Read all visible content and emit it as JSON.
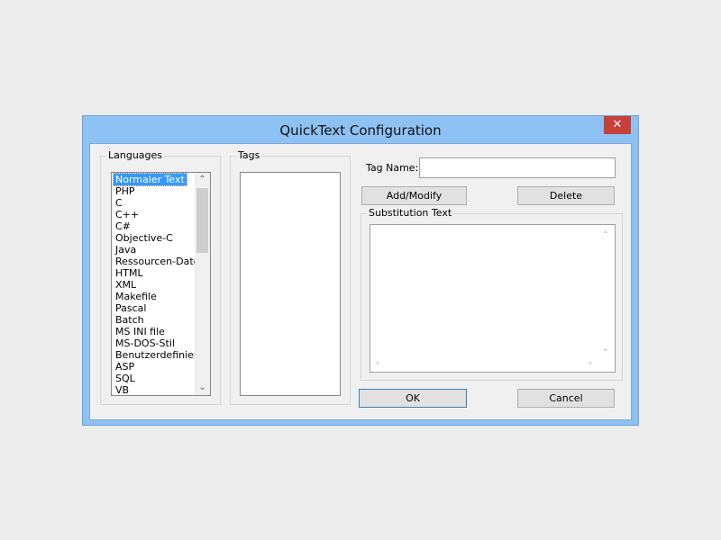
{
  "window": {
    "title": "QuickText Configuration",
    "close_glyph": "✕"
  },
  "languages": {
    "label": "Languages",
    "items": [
      "Normaler Text",
      "PHP",
      "C",
      "C++",
      "C#",
      "Objective-C",
      "Java",
      "Ressourcen-Datei",
      "HTML",
      "XML",
      "Makefile",
      "Pascal",
      "Batch",
      "MS INI file",
      "MS-DOS-Stil",
      "Benutzerdefiniert",
      "ASP",
      "SQL",
      "VB"
    ],
    "selected_index": 0
  },
  "tags": {
    "label": "Tags"
  },
  "tag_name": {
    "label": "Tag Name:",
    "value": ""
  },
  "buttons": {
    "add_modify": "Add/Modify",
    "delete": "Delete",
    "ok": "OK",
    "cancel": "Cancel"
  },
  "substitution": {
    "label": "Substitution Text",
    "value": ""
  },
  "icons": {
    "up": "chevron-up-icon",
    "down": "chevron-down-icon",
    "left": "chevron-left-icon",
    "right": "chevron-right-icon",
    "close": "close-icon"
  }
}
